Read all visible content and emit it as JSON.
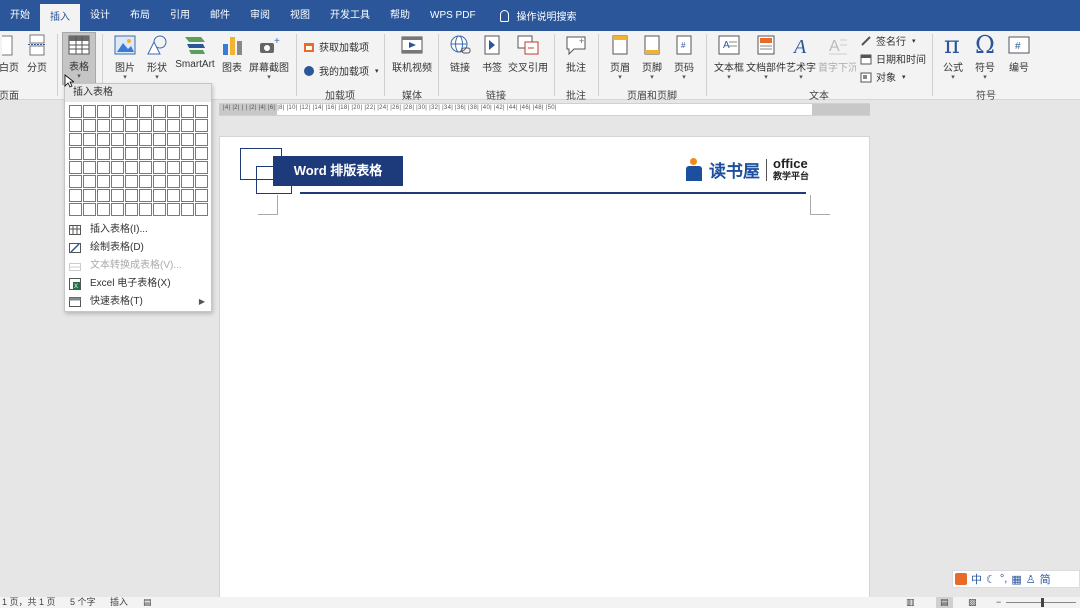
{
  "tabs": [
    "开始",
    "插入",
    "设计",
    "布局",
    "引用",
    "邮件",
    "审阅",
    "视图",
    "开发工具",
    "帮助",
    "WPS PDF"
  ],
  "active_tab": "插入",
  "tell_me": "操作说明搜索",
  "ribbon": {
    "pages_partial": "白页",
    "page_break": "分页",
    "pages_group_partial": "页面",
    "table": "表格",
    "pictures": "图片",
    "shapes": "形状",
    "smartart": "SmartArt",
    "chart": "图表",
    "screenshot": "屏幕截图",
    "get_addins": "获取加载项",
    "my_addins": "我的加载项",
    "addins_group": "加载项",
    "online_video": "联机视频",
    "media_group": "媒体",
    "link": "链接",
    "bookmark": "书签",
    "cross_ref": "交叉引用",
    "links_group": "链接",
    "comment": "批注",
    "comments_group": "批注",
    "header": "页眉",
    "footer": "页脚",
    "page_number": "页码",
    "header_footer_group": "页眉和页脚",
    "textbox": "文本框",
    "quick_parts": "文档部件",
    "wordart": "艺术字",
    "dropcap": "首字下沉",
    "signature_line": "签名行",
    "date_time": "日期和时间",
    "object": "对象",
    "text_group": "文本",
    "equation": "公式",
    "symbol": "符号",
    "numbering": "编号",
    "symbols_group": "符号"
  },
  "ruler_ticks": "|4| |2| | | |2| |4| |6| |8| |10| |12| |14| |16| |18| |20| |22| |24| |26| |28| |30| |32| |34| |36| |38| |40| |42| |44| |46| |48| |50|",
  "document": {
    "banner_title": "Word 排版表格",
    "brand_name": "读书屋",
    "brand_en": "office",
    "brand_sub": "教学平台"
  },
  "dropdown": {
    "title": "插入表格",
    "grid_cols": 10,
    "grid_rows": 8,
    "items": [
      {
        "label": "插入表格(I)...",
        "icon": "table-icon",
        "disabled": false
      },
      {
        "label": "绘制表格(D)",
        "icon": "pencil-table-icon",
        "disabled": false
      },
      {
        "label": "文本转换成表格(V)...",
        "icon": "text-to-table-icon",
        "disabled": true
      },
      {
        "label": "Excel 电子表格(X)",
        "icon": "excel-icon",
        "disabled": false
      },
      {
        "label": "快速表格(T)",
        "icon": "quick-table-icon",
        "disabled": false
      }
    ]
  },
  "status": {
    "page": "1 页，共 1 页",
    "words": "5 个字",
    "mode": "插入"
  },
  "ime": [
    "中",
    "简"
  ],
  "colors": {
    "title_bar": "#2b579a",
    "banner": "#1d3a7a",
    "brand_blue": "#1d4fa0",
    "brand_orange": "#f28a1a"
  }
}
